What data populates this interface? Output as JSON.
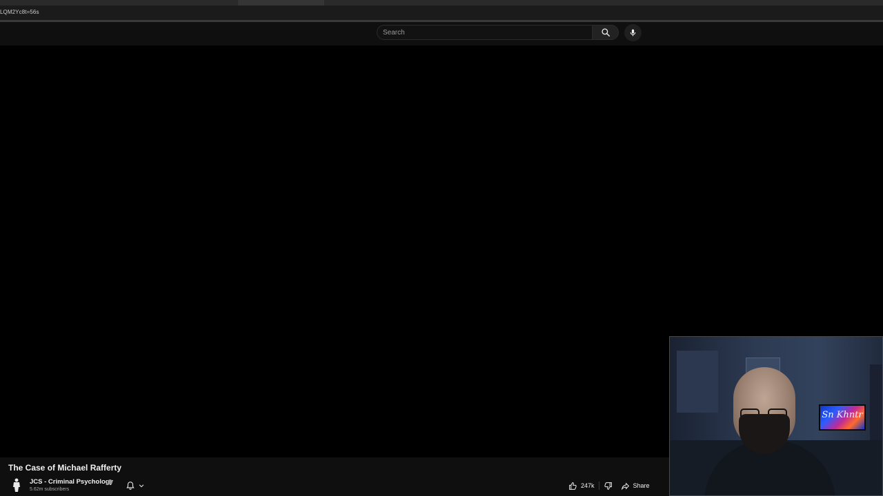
{
  "browser": {
    "url_fragment": "LQM2Yc8t=56s"
  },
  "masthead": {
    "search_placeholder": "Search",
    "search_icon": "search-icon",
    "mic_icon": "microphone-icon"
  },
  "video": {
    "title": "The Case of Michael Rafferty",
    "channel_name": "JCS - Criminal Psychology",
    "subscribers": "5.62m subscribers",
    "likes": "247k",
    "share_label": "Share"
  },
  "webcam": {
    "tv_text": "Sn Khntr"
  },
  "colors": {
    "background": "#000000",
    "masthead": "#0f0f0f",
    "text": "#f1f1f1",
    "secondary_text": "#aaaaaa"
  }
}
